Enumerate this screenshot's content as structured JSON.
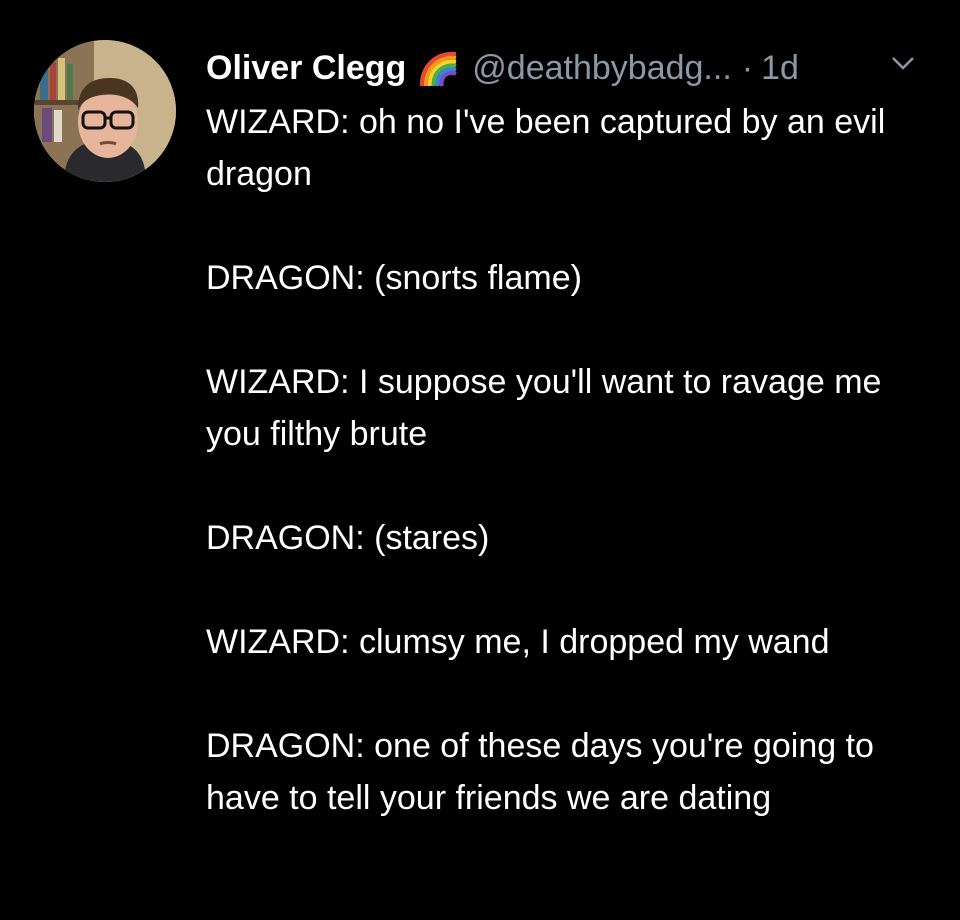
{
  "tweet": {
    "author_name": "Oliver Clegg",
    "badge_icon": "rainbow-icon",
    "handle": "@deathbybadg...",
    "separator": "·",
    "time": "1d",
    "menu_icon": "chevron-down-icon",
    "paragraphs": [
      "WIZARD: oh no I've been captured by an evil dragon",
      "DRAGON: (snorts flame)",
      "WIZARD: I suppose you'll want to ravage me you filthy brute",
      "DRAGON: (stares)",
      "WIZARD: clumsy me, I dropped my wand",
      "DRAGON: one of these days you're going to have to tell your friends we are dating"
    ]
  },
  "colors": {
    "background": "#000000",
    "text": "#ffffff",
    "muted": "#8b98a5"
  }
}
